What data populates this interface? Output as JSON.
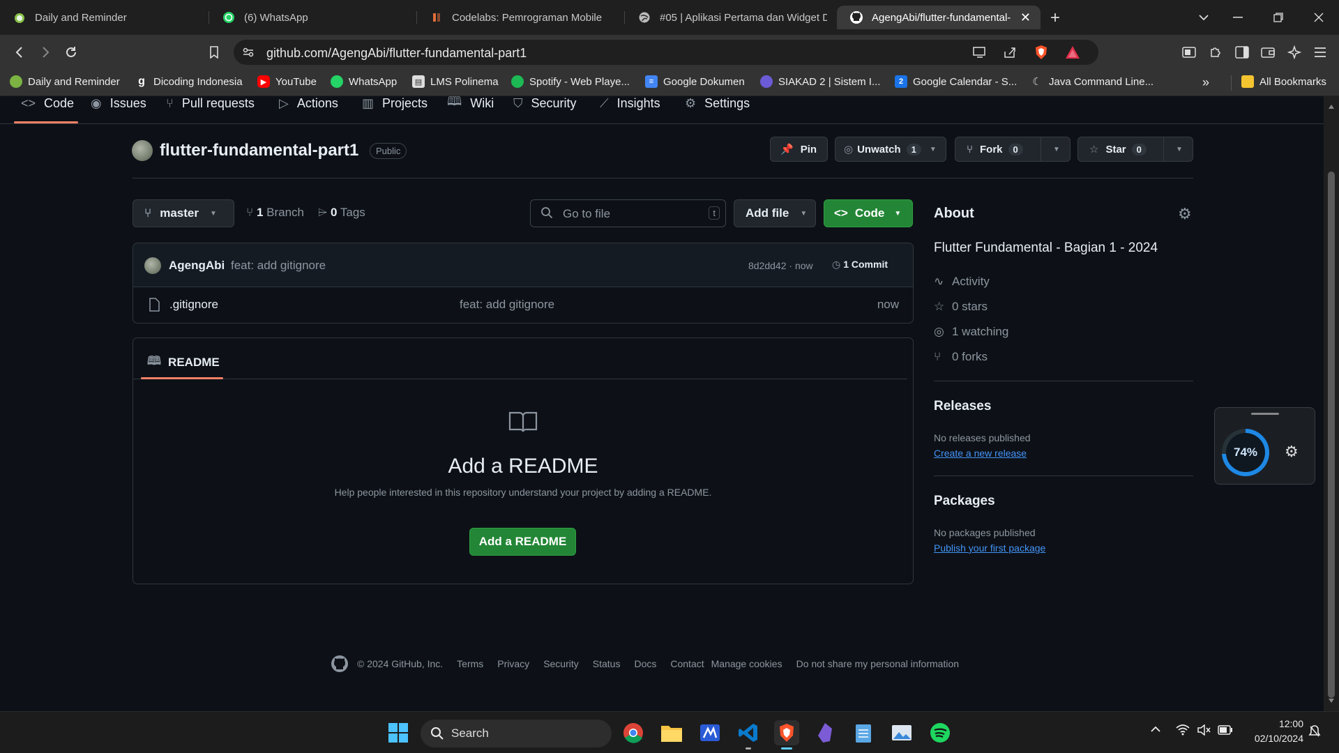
{
  "tabs": [
    {
      "label": "Daily and Reminder",
      "icon": "android-icon"
    },
    {
      "label": "(6) WhatsApp",
      "icon": "whatsapp-icon"
    },
    {
      "label": "Codelabs: Pemrograman Mobile",
      "icon": "codelabs-icon"
    },
    {
      "label": "#05 | Aplikasi Pertama dan Widget D",
      "icon": "globe-icon"
    },
    {
      "label": "AgengAbi/flutter-fundamental-",
      "icon": "github-icon"
    }
  ],
  "url": "github.com/AgengAbi/flutter-fundamental-part1",
  "bookmarks": [
    {
      "label": "Daily and Reminder",
      "color": "#7cb342",
      "icon": "android-icon"
    },
    {
      "label": "Dicoding Indonesia",
      "color": "#2d3e50",
      "icon": "dicoding-icon"
    },
    {
      "label": "YouTube",
      "color": "#ff0000",
      "icon": "youtube-icon"
    },
    {
      "label": "WhatsApp",
      "color": "#25d366",
      "icon": "whatsapp-icon"
    },
    {
      "label": "LMS Polinema",
      "color": "#cccccc",
      "icon": "lms-icon"
    },
    {
      "label": "Spotify - Web Playe...",
      "color": "#1db954",
      "icon": "spotify-icon"
    },
    {
      "label": "Google Dokumen",
      "color": "#4285f4",
      "icon": "docs-icon"
    },
    {
      "label": "SIAKAD 2 | Sistem I...",
      "color": "#6b5bd6",
      "icon": "siakad-icon"
    },
    {
      "label": "Google Calendar - S...",
      "color": "#1a73e8",
      "icon": "calendar-icon"
    },
    {
      "label": "Java Command Line...",
      "color": "#555555",
      "icon": "moon-icon"
    }
  ],
  "all_bookmarks": "All Bookmarks",
  "repo_tabs": [
    "Code",
    "Issues",
    "Pull requests",
    "Actions",
    "Projects",
    "Wiki",
    "Security",
    "Insights",
    "Settings"
  ],
  "repo": {
    "name": "flutter-fundamental-part1",
    "visibility": "Public"
  },
  "actions": {
    "pin": "Pin",
    "unwatch": "Unwatch",
    "watch_count": "1",
    "fork": "Fork",
    "fork_count": "0",
    "star": "Star",
    "star_count": "0"
  },
  "branch": {
    "name": "master",
    "branches": "1",
    "branch_label": "Branch",
    "tags": "0",
    "tag_label": "Tags"
  },
  "search": {
    "placeholder": "Go to file",
    "shortcut": "t"
  },
  "add_file": "Add file",
  "code_btn": "Code",
  "commit": {
    "author": "AgengAbi",
    "message": "feat: add gitignore",
    "hash": "8d2dd42",
    "sep": "·",
    "time": "now",
    "count": "1 Commit"
  },
  "files": [
    {
      "name": ".gitignore",
      "message": "feat: add gitignore",
      "time": "now"
    }
  ],
  "readme": {
    "tab": "README",
    "title": "Add a README",
    "desc": "Help people interested in this repository understand your project by adding a README.",
    "button": "Add a README"
  },
  "about": {
    "title": "About",
    "description": "Flutter Fundamental - Bagian 1 - 2024",
    "activity": "Activity",
    "stars": "0 stars",
    "watching": "1 watching",
    "forks": "0 forks"
  },
  "releases": {
    "title": "Releases",
    "none": "No releases published",
    "link": "Create a new release"
  },
  "packages": {
    "title": "Packages",
    "none": "No packages published",
    "link": "Publish your first package"
  },
  "footer": {
    "copyright": "© 2024 GitHub, Inc.",
    "links": [
      "Terms",
      "Privacy",
      "Security",
      "Status",
      "Docs",
      "Contact",
      "Manage cookies",
      "Do not share my personal information"
    ]
  },
  "widget": {
    "percent": "74%"
  },
  "taskbar": {
    "search": "Search",
    "time": "12:00",
    "date": "02/10/2024"
  }
}
